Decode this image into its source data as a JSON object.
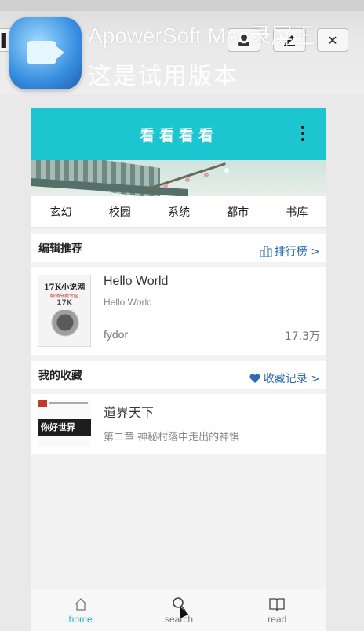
{
  "watermark": {
    "line1": "ApowerSoft Mac录屏王",
    "line2": "这是试用版本"
  },
  "toolbar": {
    "edit_icon": "pencil-icon",
    "close_label": "✕",
    "person_icon": "presenter-icon"
  },
  "app": {
    "title": "看看看看",
    "categories": [
      "玄幻",
      "校园",
      "系统",
      "都市",
      "书库"
    ]
  },
  "editor_pick": {
    "label": "编辑推荐",
    "link": "排行榜 >"
  },
  "book_featured": {
    "title": "Hello World",
    "subtitle": "Hello World",
    "author": "fydor",
    "count": "17.3万",
    "cover_title": "17K小说网",
    "cover_line": "畅销分类专区",
    "cover_brand": "17K"
  },
  "favorites": {
    "label": "我的收藏",
    "link": "收藏记录 >"
  },
  "book_fav": {
    "title": "道界天下",
    "chapter": "第二章  神秘村落中走出的神惧",
    "cover_title": "你好世界"
  },
  "tabs": [
    {
      "label": "home",
      "icon": "home-icon"
    },
    {
      "label": "search",
      "icon": "search-icon"
    },
    {
      "label": "read",
      "icon": "book-icon"
    }
  ],
  "colors": {
    "accent": "#1cc5cf",
    "link": "#2b6cb0"
  }
}
